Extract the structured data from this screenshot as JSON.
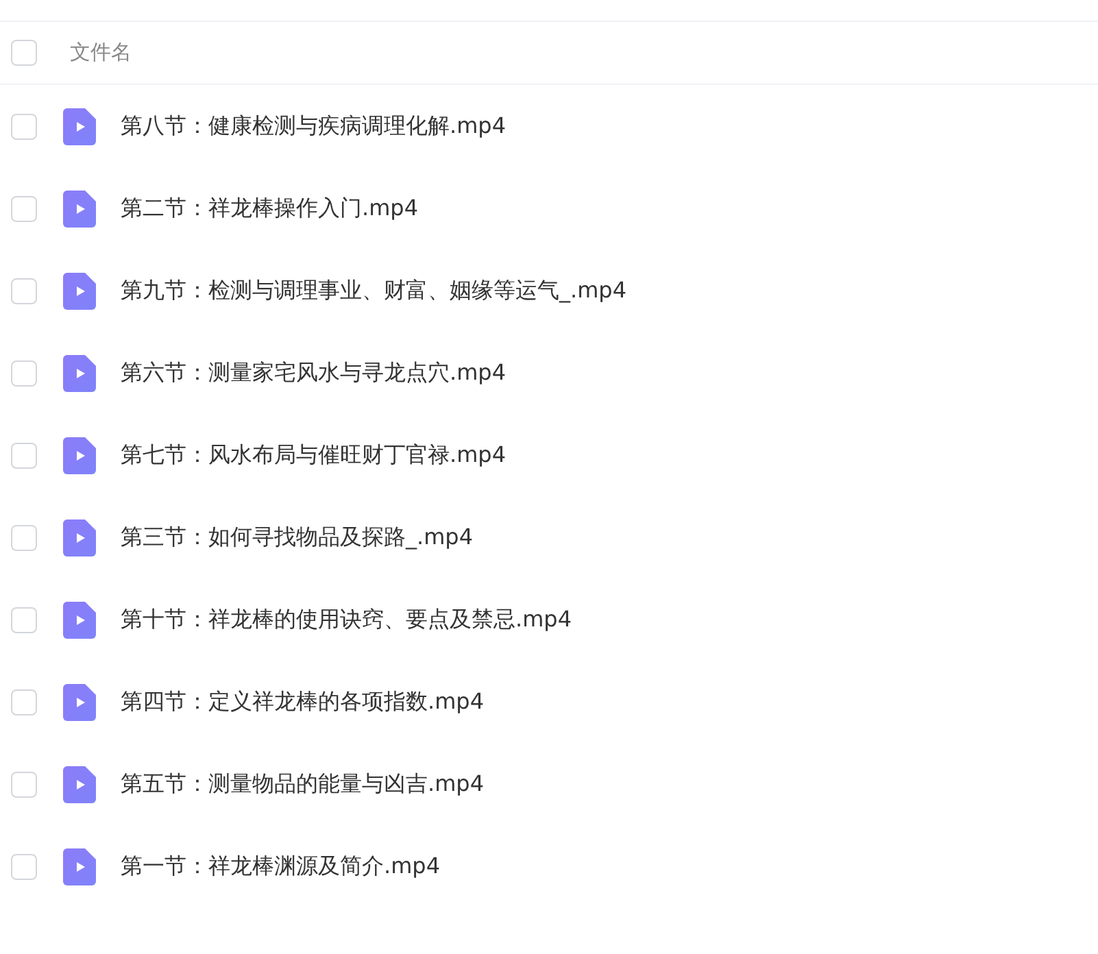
{
  "header": {
    "checked": false,
    "label": "文件名"
  },
  "files": [
    {
      "name": "第八节：健康检测与疾病调理化解.mp4",
      "checked": false
    },
    {
      "name": "第二节：祥龙棒操作入门.mp4",
      "checked": false
    },
    {
      "name": "第九节：检测与调理事业、财富、姻缘等运气_.mp4",
      "checked": false
    },
    {
      "name": "第六节：测量家宅风水与寻龙点穴.mp4",
      "checked": false
    },
    {
      "name": "第七节：风水布局与催旺财丁官禄.mp4",
      "checked": false
    },
    {
      "name": "第三节：如何寻找物品及探路_.mp4",
      "checked": false
    },
    {
      "name": "第十节：祥龙棒的使用诀窍、要点及禁忌.mp4",
      "checked": false
    },
    {
      "name": "第四节：定义祥龙棒的各项指数.mp4",
      "checked": false
    },
    {
      "name": "第五节：测量物品的能量与凶吉.mp4",
      "checked": false
    },
    {
      "name": "第一节：祥龙棒渊源及简介.mp4",
      "checked": false
    }
  ]
}
